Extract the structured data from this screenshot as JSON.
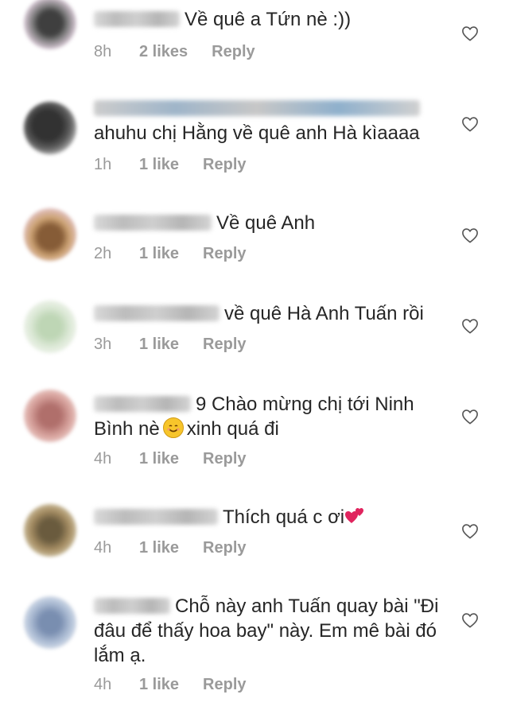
{
  "comments": [
    {
      "text": "Về quê a Tứn nè :))",
      "time": "8h",
      "likes": "2 likes",
      "reply": "Reply",
      "avatar_color": "#555555"
    },
    {
      "text": "ahuhu chị Hằng về quê anh Hà kìaaaa",
      "time": "1h",
      "likes": "1 like",
      "reply": "Reply",
      "avatar_color": "#3a3a3a"
    },
    {
      "text": "Về quê Anh",
      "time": "2h",
      "likes": "1 like",
      "reply": "Reply",
      "avatar_color": "#b8895a"
    },
    {
      "text": "về quê Hà Anh Tuấn rồi",
      "time": "3h",
      "likes": "1 like",
      "reply": "Reply",
      "avatar_color": "#cfe0c8"
    },
    {
      "text_line1": "9 Chào mừng chị tới Ninh",
      "text_line2_a": "Bình nè",
      "text_line2_b": "xinh quá đi",
      "time": "4h",
      "likes": "1 like",
      "reply": "Reply",
      "avatar_color": "#c98b86"
    },
    {
      "text": "Thích quá c ơi",
      "time": "4h",
      "likes": "1 like",
      "reply": "Reply",
      "avatar_color": "#8a6a3f"
    },
    {
      "text_line1": "Chỗ này anh Tuấn quay bài \"Đi",
      "text_line2": "đâu để thấy hoa bay\" này. Em mê bài đó",
      "text_line3": "lắm ạ.",
      "time": "4h",
      "likes": "1 like",
      "reply": "Reply",
      "avatar_color": "#9fb0c7"
    }
  ],
  "icons": {
    "like": "heart-outline-icon",
    "smile": "smiling-face-emoji",
    "hearts": "two-hearts-emoji"
  }
}
